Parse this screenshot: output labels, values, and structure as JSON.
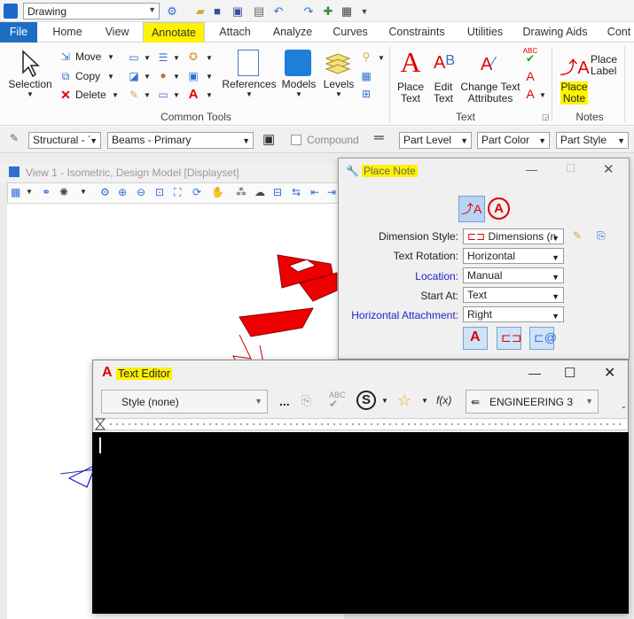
{
  "qat": {
    "workspace": "Drawing"
  },
  "tabs": [
    "File",
    "Home",
    "View",
    "Annotate",
    "Attach",
    "Analyze",
    "Curves",
    "Constraints",
    "Utilities",
    "Drawing Aids",
    "Cont"
  ],
  "ribbon": {
    "common_tools": {
      "selection": "Selection",
      "move": "Move",
      "copy": "Copy",
      "delete": "Delete",
      "references": "References",
      "models": "Models",
      "levels": "Levels",
      "group_label": "Common Tools"
    },
    "text": {
      "place_text": [
        "Place",
        "Text"
      ],
      "edit_text": [
        "Edit",
        "Text"
      ],
      "change_text_attributes": [
        "Change Text",
        "Attributes"
      ],
      "group_label": "Text"
    },
    "notes": {
      "place_label": [
        "Place",
        "Label"
      ],
      "place_note": [
        "Place",
        "Note"
      ],
      "group_label": "Notes"
    }
  },
  "attribute_bar": {
    "structural": "Structural - ´",
    "beams": "Beams - Primary",
    "compound": "Compound",
    "part_level": "Part Level",
    "part_color": "Part Color",
    "part_style": "Part Style"
  },
  "view": {
    "title": "View 1 - Isometric, Design Model [Displayset]"
  },
  "place_note": {
    "title": "Place Note",
    "dimension_style_label": "Dimension Style:",
    "dimension_style_value": "Dimensions (n",
    "text_rotation_label": "Text Rotation:",
    "text_rotation_value": "Horizontal",
    "location_label": "Location:",
    "location_value": "Manual",
    "start_at_label": "Start At:",
    "start_at_value": "Text",
    "horizontal_attachment_label": "Horizontal Attachment:",
    "horizontal_attachment_value": "Right"
  },
  "text_editor": {
    "title": "Text Editor",
    "style": "Style (none)",
    "ellipsis": "...",
    "font": "ENGINEERING 3",
    "fx": "f(x)"
  },
  "colors": {
    "highlight": "#fff200",
    "file_tab": "#1e6fc3",
    "accent_blue": "#2323c8",
    "model_red": "#ee0000"
  }
}
